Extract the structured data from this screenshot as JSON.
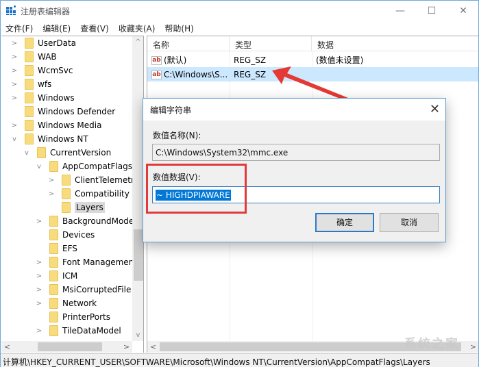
{
  "window": {
    "title": "注册表编辑器",
    "controls": {
      "minimize": "—",
      "maximize": "☐",
      "close": "✕"
    }
  },
  "menubar": [
    "文件(F)",
    "编辑(E)",
    "查看(V)",
    "收藏夹(A)",
    "帮助(H)"
  ],
  "tree": {
    "items": [
      {
        "label": "UserData",
        "level": 0,
        "expander": ">"
      },
      {
        "label": "WAB",
        "level": 0,
        "expander": ">"
      },
      {
        "label": "WcmSvc",
        "level": 0,
        "expander": ">"
      },
      {
        "label": "wfs",
        "level": 0,
        "expander": ">"
      },
      {
        "label": "Windows",
        "level": 0,
        "expander": ">"
      },
      {
        "label": "Windows Defender",
        "level": 0,
        "expander": ""
      },
      {
        "label": "Windows Media",
        "level": 0,
        "expander": ">"
      },
      {
        "label": "Windows NT",
        "level": 0,
        "expander": "v"
      },
      {
        "label": "CurrentVersion",
        "level": 1,
        "expander": "v"
      },
      {
        "label": "AppCompatFlags",
        "level": 2,
        "expander": "v"
      },
      {
        "label": "ClientTelemetr",
        "level": 3,
        "expander": ">"
      },
      {
        "label": "Compatibility A",
        "level": 3,
        "expander": ">"
      },
      {
        "label": "Layers",
        "level": 3,
        "expander": "",
        "selected": true
      },
      {
        "label": "BackgroundMode",
        "level": 2,
        "expander": ">"
      },
      {
        "label": "Devices",
        "level": 2,
        "expander": ""
      },
      {
        "label": "EFS",
        "level": 2,
        "expander": ""
      },
      {
        "label": "Font Managemen",
        "level": 2,
        "expander": ">"
      },
      {
        "label": "ICM",
        "level": 2,
        "expander": ">"
      },
      {
        "label": "MsiCorruptedFile",
        "level": 2,
        "expander": ">"
      },
      {
        "label": "Network",
        "level": 2,
        "expander": ">"
      },
      {
        "label": "PrinterPorts",
        "level": 2,
        "expander": ""
      },
      {
        "label": "TileDataModel",
        "level": 2,
        "expander": ">"
      }
    ],
    "scroll": {
      "up": "^",
      "down": "v",
      "left": "<",
      "right": ">"
    }
  },
  "list": {
    "columns": [
      "名称",
      "类型",
      "数据"
    ],
    "rows": [
      {
        "icon": "ab",
        "name": "(默认)",
        "type": "REG_SZ",
        "data": "(数值未设置)"
      },
      {
        "icon": "ab",
        "name": "C:\\Windows\\S...",
        "type": "REG_SZ",
        "data": "",
        "selected": true
      }
    ],
    "scroll": {
      "left": "<",
      "right": ">"
    }
  },
  "dialog": {
    "title": "编辑字符串",
    "close": "✕",
    "name_label": "数值名称(N):",
    "name_value": "C:\\Windows\\System32\\mmc.exe",
    "data_label": "数值数据(V):",
    "data_value": "~ HIGHDPIAWARE",
    "ok": "确定",
    "cancel": "取消"
  },
  "statusbar": "计算机\\HKEY_CURRENT_USER\\SOFTWARE\\Microsoft\\Windows NT\\CurrentVersion\\AppCompatFlags\\Layers",
  "watermark": "系统之家",
  "colors": {
    "highlight": "#e03a3a",
    "selection": "#cce8ff",
    "accent": "#0078d7"
  }
}
